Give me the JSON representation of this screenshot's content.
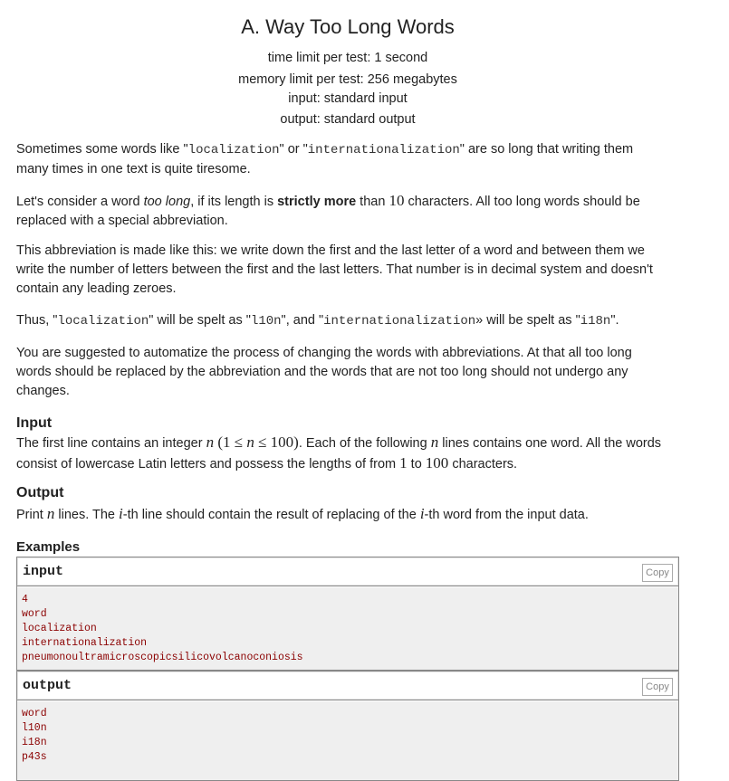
{
  "problem": {
    "title": "A. Way Too Long Words",
    "time_limit": "time limit per test: 1 second",
    "memory_limit": "memory limit per test: 256 megabytes",
    "input_type": "input: standard input",
    "output_type": "output: standard output"
  },
  "statement": {
    "p1": {
      "a": "Sometimes some words like \"",
      "code1": "localization",
      "b": "\" or \"",
      "code2": "internationalization",
      "c": "\" are so long that writing them",
      "line2": "many times in one text is quite tiresome."
    },
    "p2": {
      "a": "Let's consider a word ",
      "em": "too long",
      "b": ", if its length is ",
      "strong": "strictly more",
      "c": " than ",
      "num": "10",
      "d": " characters. All too long words should be",
      "line2": "replaced with a special abbreviation."
    },
    "p3": {
      "line1": "This abbreviation is made like this: we write down the first and the last letter of a word and between them we",
      "line2": "write the number of letters between the first and the last letters. That number is in decimal system and doesn't",
      "line3": "contain any leading zeroes."
    },
    "p4": {
      "a": "Thus, \"",
      "code1": "localization",
      "b": "\" will be spelt as \"",
      "code2": "l10n",
      "c": "\", and \"",
      "code3": "internationalization",
      "d": "» will be spelt as \"",
      "code4": "i18n",
      "e": "\"."
    },
    "p5": {
      "line1": "You are suggested to automatize the process of changing the words with abbreviations. At that all too long",
      "line2": "words should be replaced by the abbreviation and the words that are not too long should not undergo any",
      "line3": "changes."
    }
  },
  "input_spec": {
    "heading": "Input",
    "a": "The first line contains an integer ",
    "n": "n",
    "range": " (1 ≤ ",
    "n2": "n",
    "range2": " ≤ 100)",
    "b": ". Each of the following ",
    "n3": "n",
    "c": " lines contains one word. All the words",
    "line2a": "consist of lowercase Latin letters and possess the lengths of from ",
    "one": "1",
    "to": " to ",
    "hundred": "100",
    "line2b": " characters."
  },
  "output_spec": {
    "heading": "Output",
    "a": "Print ",
    "n": "n",
    "b": " lines. The ",
    "i": "i",
    "c": "-th line should contain the result of replacing of the ",
    "i2": "i",
    "d": "-th word from the input data."
  },
  "examples": {
    "heading": "Examples",
    "input_label": "input",
    "output_label": "output",
    "copy_label": "Copy",
    "input_lines": [
      "4",
      "word",
      "localization",
      "internationalization",
      "pneumonoultramicroscopicsilicovolcanoconiosis"
    ],
    "output_lines": [
      "word",
      "l10n",
      "i18n",
      "p43s"
    ]
  }
}
